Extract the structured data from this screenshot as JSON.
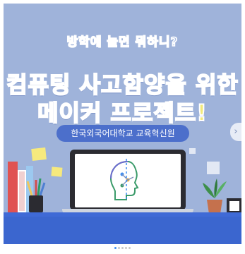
{
  "post": {
    "overline": "방학에 놀면 뭐하니?",
    "headline_line1": "컴퓨팅 사고함양을 위한",
    "headline_line2": "메이커 프로젝트!",
    "organization": "한국외국어대학교 교육혁신원"
  },
  "carousel": {
    "next_icon": "chevron-right-icon",
    "dots": [
      {
        "active": true
      },
      {
        "active": false
      },
      {
        "active": false
      },
      {
        "active": false
      },
      {
        "active": false
      }
    ]
  },
  "colors": {
    "background": "#9fb3da",
    "headline_fill": "#f2ea7a",
    "pill": "#4c6fcb",
    "desk": "#3f6ad6",
    "active_dot": "#3f8ef2"
  },
  "illustration": {
    "screen_icon": "ai-brain-head-icon",
    "left_props": "books-and-pencil-cup",
    "right_props": "potted-plant-and-box"
  }
}
